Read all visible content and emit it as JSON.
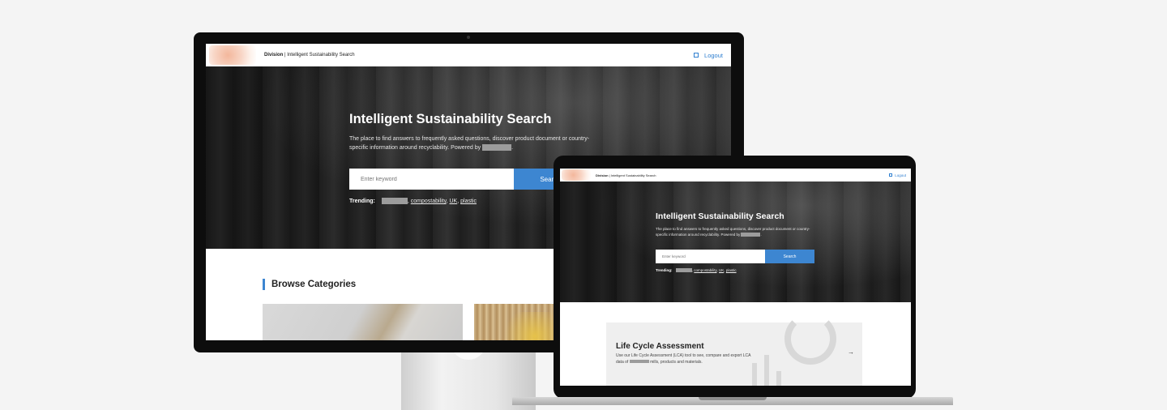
{
  "header": {
    "brand_bold": "Division",
    "brand_rest": " | Intelligent Sustainability Search",
    "logout_label": "Logout"
  },
  "hero": {
    "title": "Intelligent Sustainability Search",
    "description_part1": "The place to find answers to frequently asked questions, discover product document or country-specific information around recyclability. Powered by",
    "description_end": ".",
    "search_placeholder": "Enter keyword",
    "search_button": "Search",
    "trending_label": "Trending:",
    "trending_sep": ",",
    "trending_items": [
      "compostability",
      "UK",
      "plastic"
    ]
  },
  "browse": {
    "title": "Browse Categories"
  },
  "lca_card": {
    "title": "Life Cycle Assessment",
    "description_part1": "Use our Life Cycle Assessment (LCA) tool to see, compare and export LCA data of",
    "description_part2": "mills, products and materials.",
    "arrow": "→"
  },
  "icons": {
    "logout": "logout-icon",
    "arrow": "arrow-right-icon"
  },
  "colors": {
    "accent": "#3d86d1",
    "link": "#2f7fd0"
  }
}
